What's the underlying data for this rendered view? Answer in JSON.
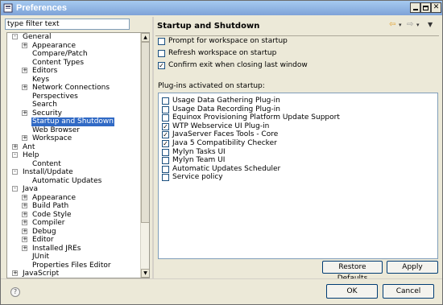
{
  "window": {
    "title": "Preferences"
  },
  "filter": {
    "placeholder": "type filter text",
    "value": "type filter text"
  },
  "tree": [
    {
      "label": "General",
      "depth": 0,
      "exp": "-"
    },
    {
      "label": "Appearance",
      "depth": 1,
      "exp": "+"
    },
    {
      "label": "Compare/Patch",
      "depth": 1,
      "exp": ""
    },
    {
      "label": "Content Types",
      "depth": 1,
      "exp": ""
    },
    {
      "label": "Editors",
      "depth": 1,
      "exp": "+"
    },
    {
      "label": "Keys",
      "depth": 1,
      "exp": ""
    },
    {
      "label": "Network Connections",
      "depth": 1,
      "exp": "+"
    },
    {
      "label": "Perspectives",
      "depth": 1,
      "exp": ""
    },
    {
      "label": "Search",
      "depth": 1,
      "exp": ""
    },
    {
      "label": "Security",
      "depth": 1,
      "exp": "+"
    },
    {
      "label": "Startup and Shutdown",
      "depth": 1,
      "exp": "",
      "selected": true
    },
    {
      "label": "Web Browser",
      "depth": 1,
      "exp": ""
    },
    {
      "label": "Workspace",
      "depth": 1,
      "exp": "+"
    },
    {
      "label": "Ant",
      "depth": 0,
      "exp": "+"
    },
    {
      "label": "Help",
      "depth": 0,
      "exp": "-"
    },
    {
      "label": "Content",
      "depth": 1,
      "exp": ""
    },
    {
      "label": "Install/Update",
      "depth": 0,
      "exp": "-"
    },
    {
      "label": "Automatic Updates",
      "depth": 1,
      "exp": ""
    },
    {
      "label": "Java",
      "depth": 0,
      "exp": "-"
    },
    {
      "label": "Appearance",
      "depth": 1,
      "exp": "+"
    },
    {
      "label": "Build Path",
      "depth": 1,
      "exp": "+"
    },
    {
      "label": "Code Style",
      "depth": 1,
      "exp": "+"
    },
    {
      "label": "Compiler",
      "depth": 1,
      "exp": "+"
    },
    {
      "label": "Debug",
      "depth": 1,
      "exp": "+"
    },
    {
      "label": "Editor",
      "depth": 1,
      "exp": "+"
    },
    {
      "label": "Installed JREs",
      "depth": 1,
      "exp": "+"
    },
    {
      "label": "JUnit",
      "depth": 1,
      "exp": ""
    },
    {
      "label": "Properties Files Editor",
      "depth": 1,
      "exp": ""
    },
    {
      "label": "JavaScript",
      "depth": 0,
      "exp": "+"
    }
  ],
  "page": {
    "title": "Startup and Shutdown",
    "options": [
      {
        "label": "Prompt for workspace on startup",
        "checked": false
      },
      {
        "label": "Refresh workspace on startup",
        "checked": false
      },
      {
        "label": "Confirm exit when closing last window",
        "checked": true
      }
    ],
    "plugins_label": "Plug-ins activated on startup:",
    "plugins": [
      {
        "label": "Usage Data Gathering Plug-in",
        "checked": false
      },
      {
        "label": "Usage Data Recording Plug-in",
        "checked": false
      },
      {
        "label": "Equinox Provisioning Platform Update Support",
        "checked": false
      },
      {
        "label": "WTP Webservice UI Plug-in",
        "checked": true
      },
      {
        "label": "JavaServer Faces Tools - Core",
        "checked": true
      },
      {
        "label": "Java 5 Compatibility Checker",
        "checked": true
      },
      {
        "label": "Mylyn Tasks UI",
        "checked": false
      },
      {
        "label": "Mylyn Team UI",
        "checked": false
      },
      {
        "label": "Automatic Updates Scheduler",
        "checked": false
      },
      {
        "label": "Service policy",
        "checked": false
      }
    ],
    "restore_label": "Restore Defaults",
    "apply_label": "Apply"
  },
  "dialog": {
    "ok_label": "OK",
    "cancel_label": "Cancel"
  },
  "icons": {
    "back": "back-arrow-icon",
    "forward": "forward-arrow-icon",
    "menu": "view-menu-icon",
    "help": "help-icon"
  },
  "colors": {
    "selection": "#316ac5",
    "titlebar": "#7ea3d8"
  }
}
